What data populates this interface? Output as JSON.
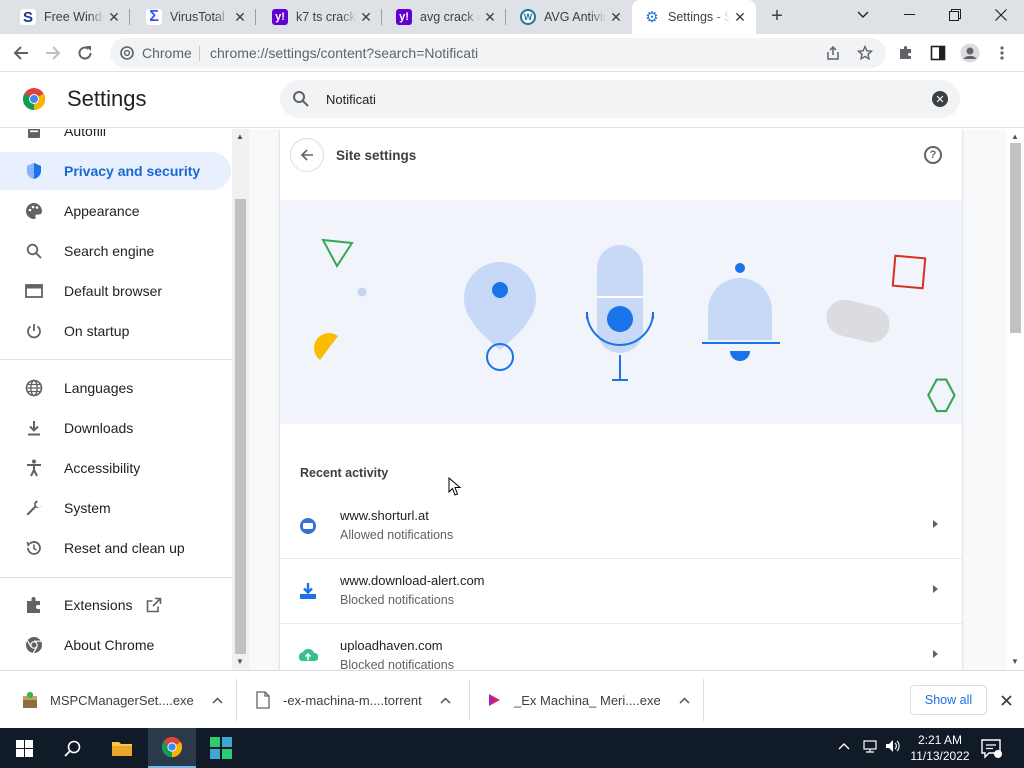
{
  "tabs": [
    {
      "title": "Free Windows",
      "favicon_letter": "S",
      "favicon_color": "#1e3a8a",
      "icon": "s-logo-icon"
    },
    {
      "title": "VirusTotal - ",
      "favicon_letter": "Σ",
      "favicon_color": "#394eff",
      "icon": "virustotal-icon"
    },
    {
      "title": "k7 ts crack",
      "favicon_letter": "y!",
      "favicon_color": "#6001d2",
      "icon": "yahoo-icon"
    },
    {
      "title": "avg crack d",
      "favicon_letter": "y!",
      "favicon_color": "#6001d2",
      "icon": "yahoo-icon"
    },
    {
      "title": "AVG Antivir",
      "favicon_letter": "W",
      "favicon_color": "#21759b",
      "icon": "wordpress-icon"
    },
    {
      "title": "Settings - S",
      "favicon_letter": "⚙",
      "favicon_color": "#1a73e8",
      "icon": "settings-gear-icon"
    }
  ],
  "omnibox": {
    "chip_label": "Chrome",
    "url": "chrome://settings/content?search=Notificati"
  },
  "header": {
    "title": "Settings",
    "search_value": "Notificati"
  },
  "sidebar": {
    "items": [
      {
        "label": "Autofill",
        "icon": "autofill-icon"
      },
      {
        "label": "Privacy and security",
        "icon": "shield-icon"
      },
      {
        "label": "Appearance",
        "icon": "palette-icon"
      },
      {
        "label": "Search engine",
        "icon": "search-icon"
      },
      {
        "label": "Default browser",
        "icon": "browser-icon"
      },
      {
        "label": "On startup",
        "icon": "power-icon"
      },
      {
        "label": "Languages",
        "icon": "globe-icon"
      },
      {
        "label": "Downloads",
        "icon": "download-icon"
      },
      {
        "label": "Accessibility",
        "icon": "accessibility-icon"
      },
      {
        "label": "System",
        "icon": "wrench-icon"
      },
      {
        "label": "Reset and clean up",
        "icon": "reset-icon"
      },
      {
        "label": "Extensions",
        "icon": "puzzle-icon"
      },
      {
        "label": "About Chrome",
        "icon": "chrome-icon"
      }
    ]
  },
  "site_settings": {
    "title": "Site settings",
    "recent_heading": "Recent activity",
    "recent": [
      {
        "site": "www.shorturl.at",
        "status": "Allowed notifications",
        "icon": "shorturl-icon"
      },
      {
        "site": "www.download-alert.com",
        "status": "Blocked notifications",
        "icon": "download-alert-icon"
      },
      {
        "site": "uploadhaven.com",
        "status": "Blocked notifications",
        "icon": "uploadhaven-icon"
      }
    ]
  },
  "downloads": {
    "items": [
      {
        "name": "MSPCManagerSet....exe",
        "icon": "installer-icon"
      },
      {
        "name": "-ex-machina-m....torrent",
        "icon": "file-icon"
      },
      {
        "name": "_Ex Machina_ Meri....exe",
        "icon": "media-icon"
      }
    ],
    "show_all": "Show all"
  },
  "taskbar": {
    "time": "2:21 AM",
    "date": "11/13/2022"
  },
  "colors": {
    "accent": "#1a73e8",
    "active_bg": "#e8f0fe",
    "tabstrip": "#dee1e6",
    "taskbar": "#101b27"
  }
}
